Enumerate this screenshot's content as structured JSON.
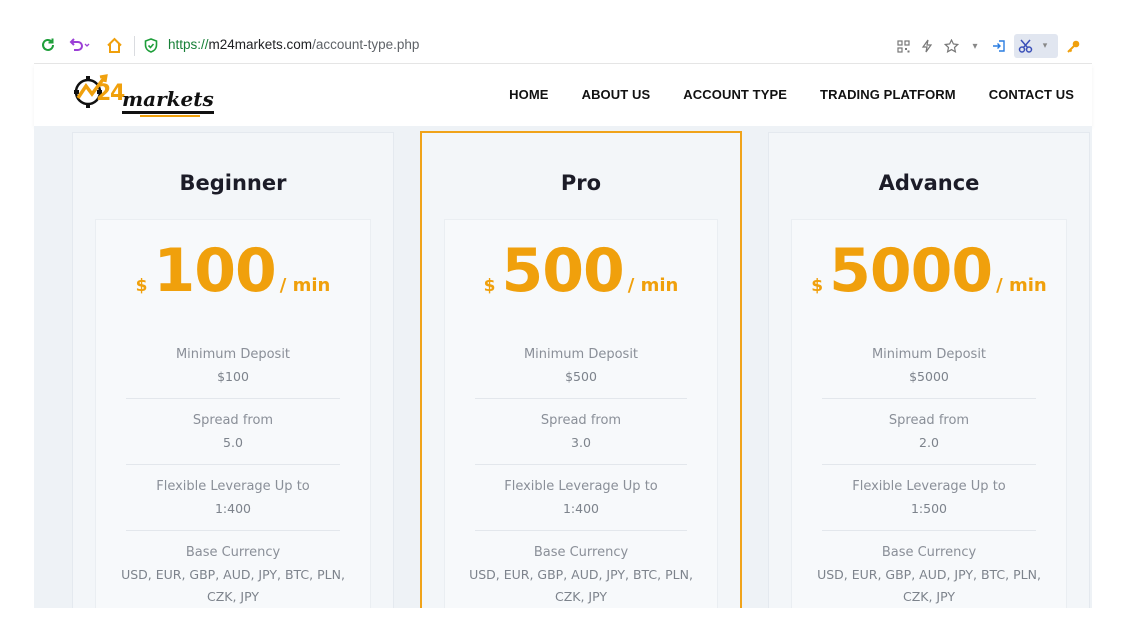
{
  "browser": {
    "url_protocol": "https://",
    "url_domain": "m24markets.com",
    "url_path": "/account-type.php"
  },
  "site": {
    "logo_alt": "m24markets",
    "nav": [
      {
        "label": "HOME"
      },
      {
        "label": "ABOUT US"
      },
      {
        "label": "ACCOUNT TYPE"
      },
      {
        "label": "TRADING PLATFORM"
      },
      {
        "label": "CONTACT US"
      }
    ]
  },
  "plans": [
    {
      "title": "Beginner",
      "currency": "$",
      "amount": "100",
      "period": "/ min",
      "features": [
        {
          "label": "Minimum Deposit",
          "value": "$100"
        },
        {
          "label": "Spread from",
          "value": "5.0"
        },
        {
          "label": "Flexible Leverage Up to",
          "value": "1:400"
        },
        {
          "label": "Base Currency",
          "value": "USD, EUR, GBP, AUD, JPY, BTC, PLN, CZK, JPY"
        }
      ]
    },
    {
      "title": "Pro",
      "currency": "$",
      "amount": "500",
      "period": "/ min",
      "features": [
        {
          "label": "Minimum Deposit",
          "value": "$500"
        },
        {
          "label": "Spread from",
          "value": "3.0"
        },
        {
          "label": "Flexible Leverage Up to",
          "value": "1:400"
        },
        {
          "label": "Base Currency",
          "value": "USD, EUR, GBP, AUD, JPY, BTC, PLN, CZK, JPY"
        }
      ]
    },
    {
      "title": "Advance",
      "currency": "$",
      "amount": "5000",
      "period": "/ min",
      "features": [
        {
          "label": "Minimum Deposit",
          "value": "$5000"
        },
        {
          "label": "Spread from",
          "value": "2.0"
        },
        {
          "label": "Flexible Leverage Up to",
          "value": "1:500"
        },
        {
          "label": "Base Currency",
          "value": "USD, EUR, GBP, AUD, JPY, BTC, PLN, CZK, JPY"
        }
      ]
    }
  ],
  "colors": {
    "accent": "#f0a00c",
    "featured_border": "#f0a31a",
    "page_bg": "#eef2f6"
  }
}
